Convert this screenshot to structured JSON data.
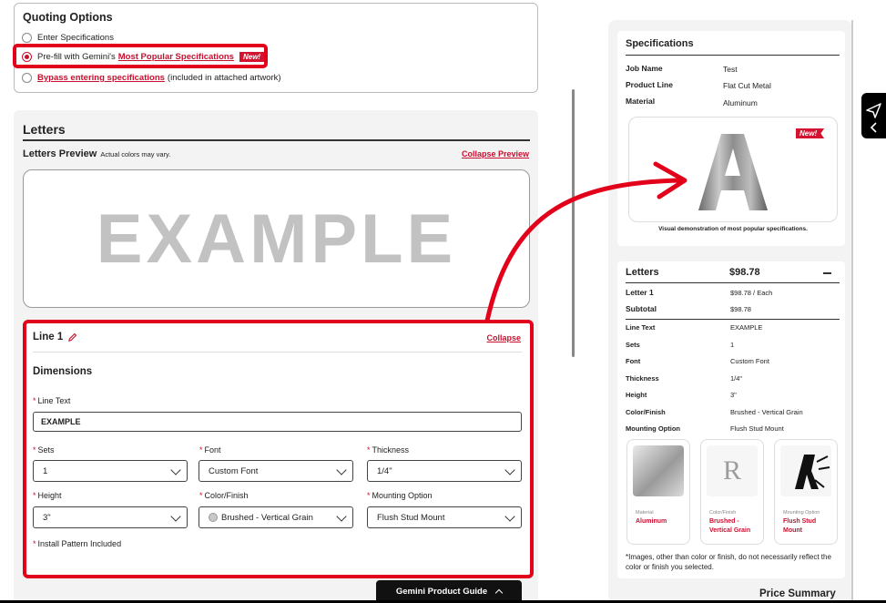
{
  "quoting": {
    "title": "Quoting Options",
    "option1": "Enter Specifications",
    "option2_prefix": "Pre-fill with Gemini's",
    "option2_link": "Most Popular Specifications",
    "new_badge": "New!",
    "option3_link": "Bypass entering specifications",
    "option3_suffix": "(included in attached artwork)"
  },
  "letters": {
    "title": "Letters",
    "preview_label": "Letters Preview",
    "preview_note": "Actual colors may vary.",
    "collapse_preview": "Collapse Preview",
    "preview_text": "EXAMPLE"
  },
  "line1": {
    "title": "Line 1",
    "collapse": "Collapse",
    "dimensions": "Dimensions",
    "line_text_label": "Line Text",
    "line_text_value": "EXAMPLE",
    "sets_label": "Sets",
    "sets_value": "1",
    "font_label": "Font",
    "font_value": "Custom Font",
    "thickness_label": "Thickness",
    "thickness_value": "1/4\"",
    "height_label": "Height",
    "height_value": "3\"",
    "color_label": "Color/Finish",
    "color_value": "Brushed - Vertical Grain",
    "mounting_label": "Mounting Option",
    "mounting_value": "Flush Stud Mount",
    "install_label": "Install Pattern Included"
  },
  "guide_button": "Gemini Product Guide",
  "specs": {
    "title": "Specifications",
    "job_name_k": "Job Name",
    "job_name_v": "Test",
    "product_line_k": "Product Line",
    "product_line_v": "Flat Cut Metal",
    "material_k": "Material",
    "material_v": "Aluminum",
    "demo_letter": "A",
    "demo_caption": "Visual demonstration of most popular specifications.",
    "new_badge": "New!"
  },
  "summary": {
    "title": "Letters",
    "total": "$98.78",
    "letter1_k": "Letter 1",
    "letter1_v": "$98.78 / Each",
    "subtotal_k": "Subtotal",
    "subtotal_v": "$98.78",
    "rows": [
      {
        "k": "Line Text",
        "v": "EXAMPLE"
      },
      {
        "k": "Sets",
        "v": "1"
      },
      {
        "k": "Font",
        "v": "Custom Font"
      },
      {
        "k": "Thickness",
        "v": "1/4\""
      },
      {
        "k": "Height",
        "v": "3\""
      },
      {
        "k": "Color/Finish",
        "v": "Brushed - Vertical Grain"
      },
      {
        "k": "Mounting Option",
        "v": "Flush Stud Mount"
      }
    ],
    "thumbs": [
      {
        "label": "Material",
        "value": "Aluminum"
      },
      {
        "label": "Color/Finish",
        "value": "Brushed - Vertical Grain"
      },
      {
        "label": "Mounting Option",
        "value": "Flush Stud Mount"
      }
    ],
    "thumb_r": "R",
    "disclaimer": "*Images, other than color or finish, do not necessarily reflect the color or finish you selected.",
    "price_summary": "Price Summary"
  },
  "colors": {
    "accent": "#c8102e",
    "highlight": "#e3001b"
  }
}
